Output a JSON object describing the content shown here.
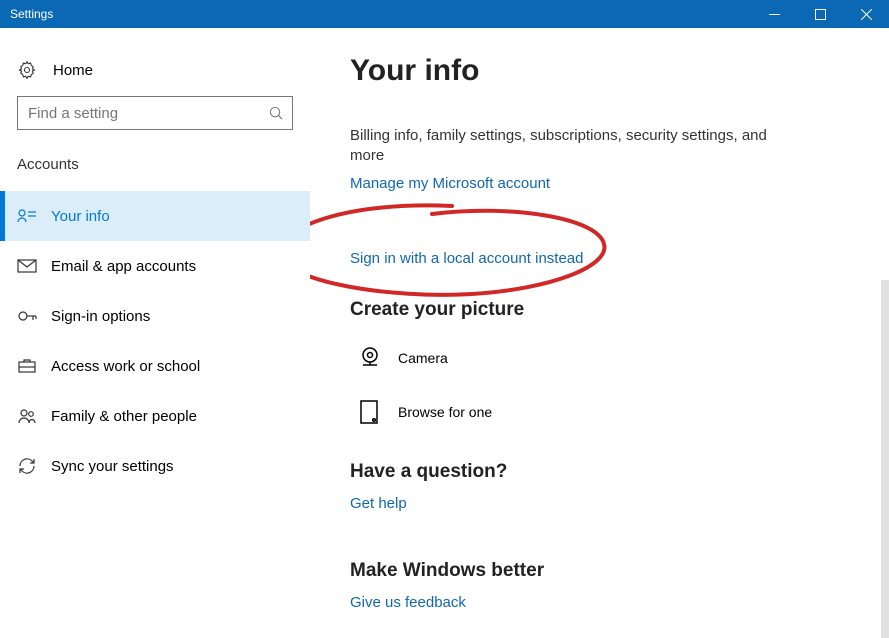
{
  "titlebar": {
    "title": "Settings"
  },
  "sidebar": {
    "home_label": "Home",
    "search_placeholder": "Find a setting",
    "section_label": "Accounts",
    "items": [
      {
        "label": "Your info"
      },
      {
        "label": "Email & app accounts"
      },
      {
        "label": "Sign-in options"
      },
      {
        "label": "Access work or school"
      },
      {
        "label": "Family & other people"
      },
      {
        "label": "Sync your settings"
      }
    ]
  },
  "main": {
    "page_title": "Your info",
    "description": "Billing info, family settings, subscriptions, security settings, and more",
    "manage_link": "Manage my Microsoft account",
    "local_account_link": "Sign in with a local account instead",
    "picture_heading": "Create your picture",
    "camera_label": "Camera",
    "browse_label": "Browse for one",
    "question_heading": "Have a question?",
    "get_help_link": "Get help",
    "better_heading": "Make Windows better",
    "feedback_link": "Give us feedback"
  }
}
